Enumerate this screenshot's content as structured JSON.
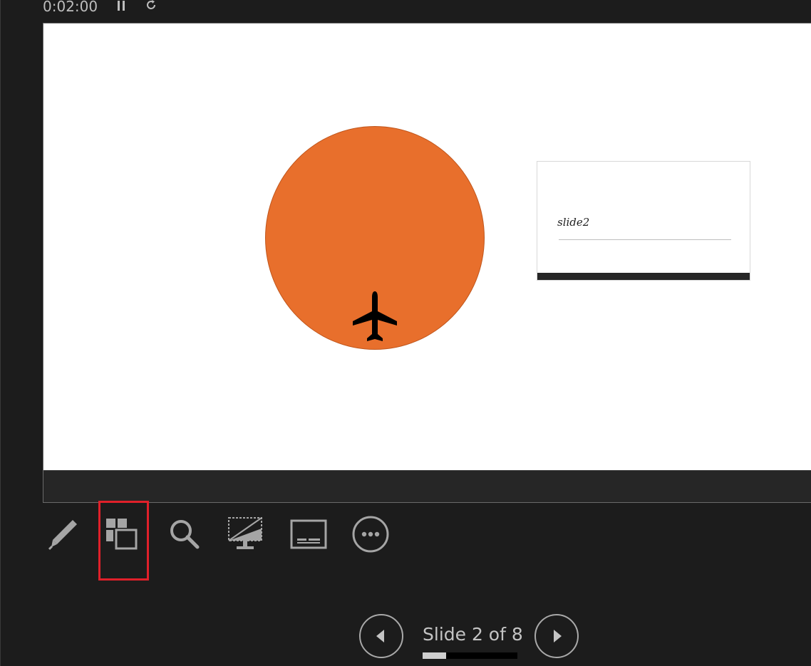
{
  "header": {
    "timer": "0:02:00",
    "pause_icon": "pause-icon",
    "restart_icon": "restart-icon"
  },
  "slide": {
    "shape_color": "#e86f2c",
    "icon": "airplane-icon",
    "mini_slide_title": "slide2"
  },
  "toolbar": {
    "items": [
      {
        "icon": "pen-icon"
      },
      {
        "icon": "see-all-slides-icon"
      },
      {
        "icon": "zoom-icon"
      },
      {
        "icon": "black-screen-icon"
      },
      {
        "icon": "subtitles-icon"
      },
      {
        "icon": "more-options-icon"
      }
    ],
    "highlight_color": "#e0202a"
  },
  "navigation": {
    "prev_icon": "previous-slide-icon",
    "next_icon": "next-slide-icon",
    "counter_text": "Slide 2 of 8",
    "current_slide": 2,
    "total_slides": 8
  }
}
